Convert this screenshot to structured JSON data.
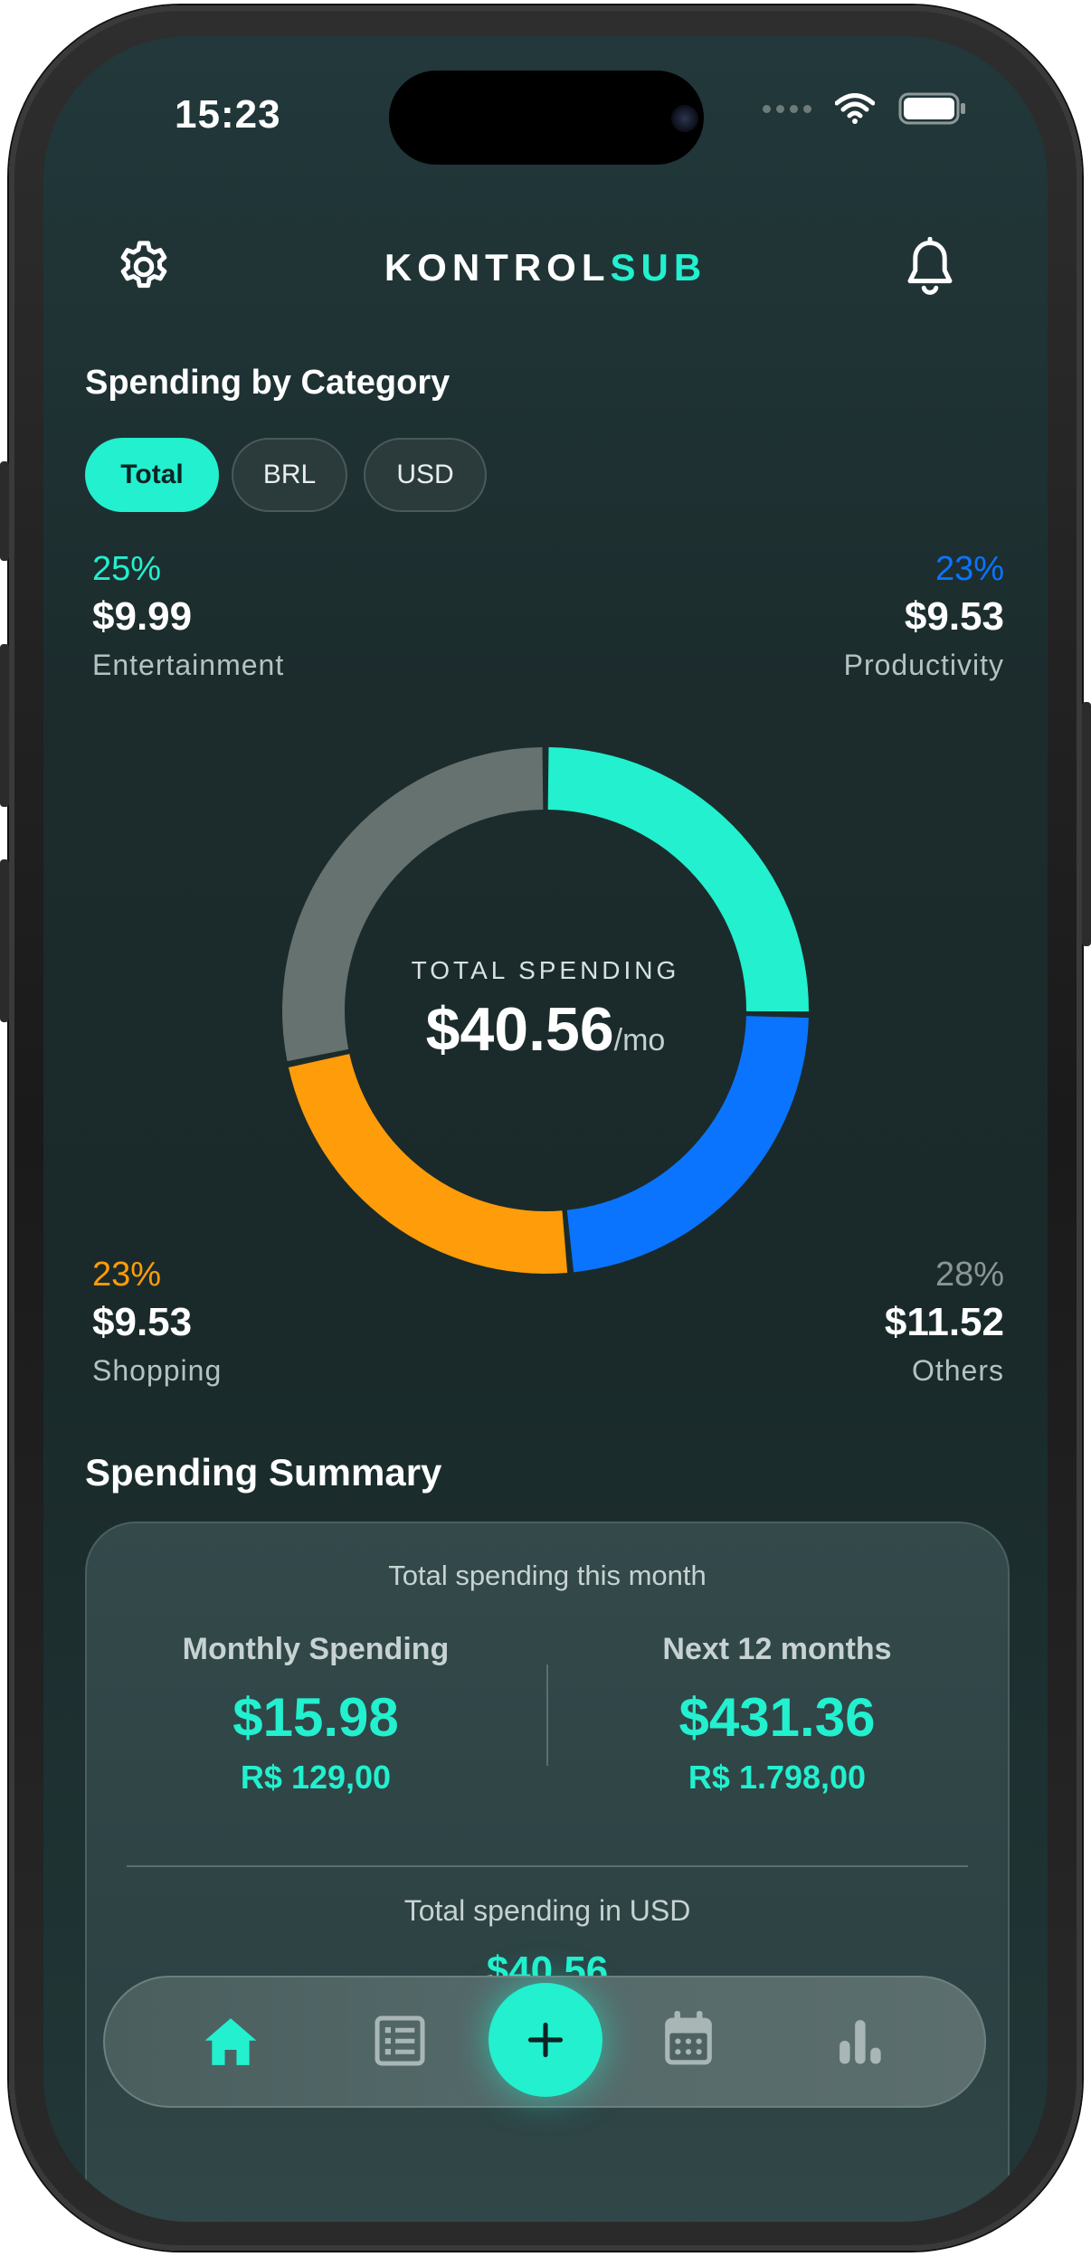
{
  "status_bar": {
    "time": "15:23"
  },
  "header": {
    "title_part1": "KONTROL",
    "title_part2": "SUB"
  },
  "category_section": {
    "title": "Spending by Category",
    "filters": [
      {
        "label": "Total",
        "active": true
      },
      {
        "label": "BRL",
        "active": false
      },
      {
        "label": "USD",
        "active": false
      }
    ],
    "categories": [
      {
        "pct": "25%",
        "amount": "$9.99",
        "label": "Entertainment",
        "color": "#22f0cf"
      },
      {
        "pct": "23%",
        "amount": "$9.53",
        "label": "Productivity",
        "color": "#0a74ff"
      },
      {
        "pct": "23%",
        "amount": "$9.53",
        "label": "Shopping",
        "color": "#ff9c0a"
      },
      {
        "pct": "28%",
        "amount": "$11.52",
        "label": "Others",
        "color": "#66726f"
      }
    ],
    "center": {
      "caption": "TOTAL SPENDING",
      "amount": "$40.56",
      "unit": "/mo"
    }
  },
  "chart_data": {
    "type": "pie",
    "categories": [
      "Entertainment",
      "Productivity",
      "Shopping",
      "Others"
    ],
    "values": [
      25,
      23,
      23,
      28
    ],
    "colors": [
      "#22f0cf",
      "#0a74ff",
      "#ff9c0a",
      "#66726f"
    ]
  },
  "summary": {
    "title": "Spending Summary",
    "subtitle": "Total spending this month",
    "monthly_label": "Monthly Spending",
    "monthly_usd": "$15.98",
    "monthly_brl": "R$ 129,00",
    "year_label": "Next 12 months",
    "year_usd": "$431.36",
    "year_brl": "R$ 1.798,00",
    "usd_label": "Total spending in USD",
    "usd_total": "$40.56"
  },
  "nav": {
    "items": [
      {
        "icon": "home-icon",
        "active": true
      },
      {
        "icon": "list-icon",
        "active": false
      },
      {
        "icon": "plus-icon",
        "active": false
      },
      {
        "icon": "calendar-icon",
        "active": false
      },
      {
        "icon": "bar-chart-icon",
        "active": false
      }
    ]
  }
}
